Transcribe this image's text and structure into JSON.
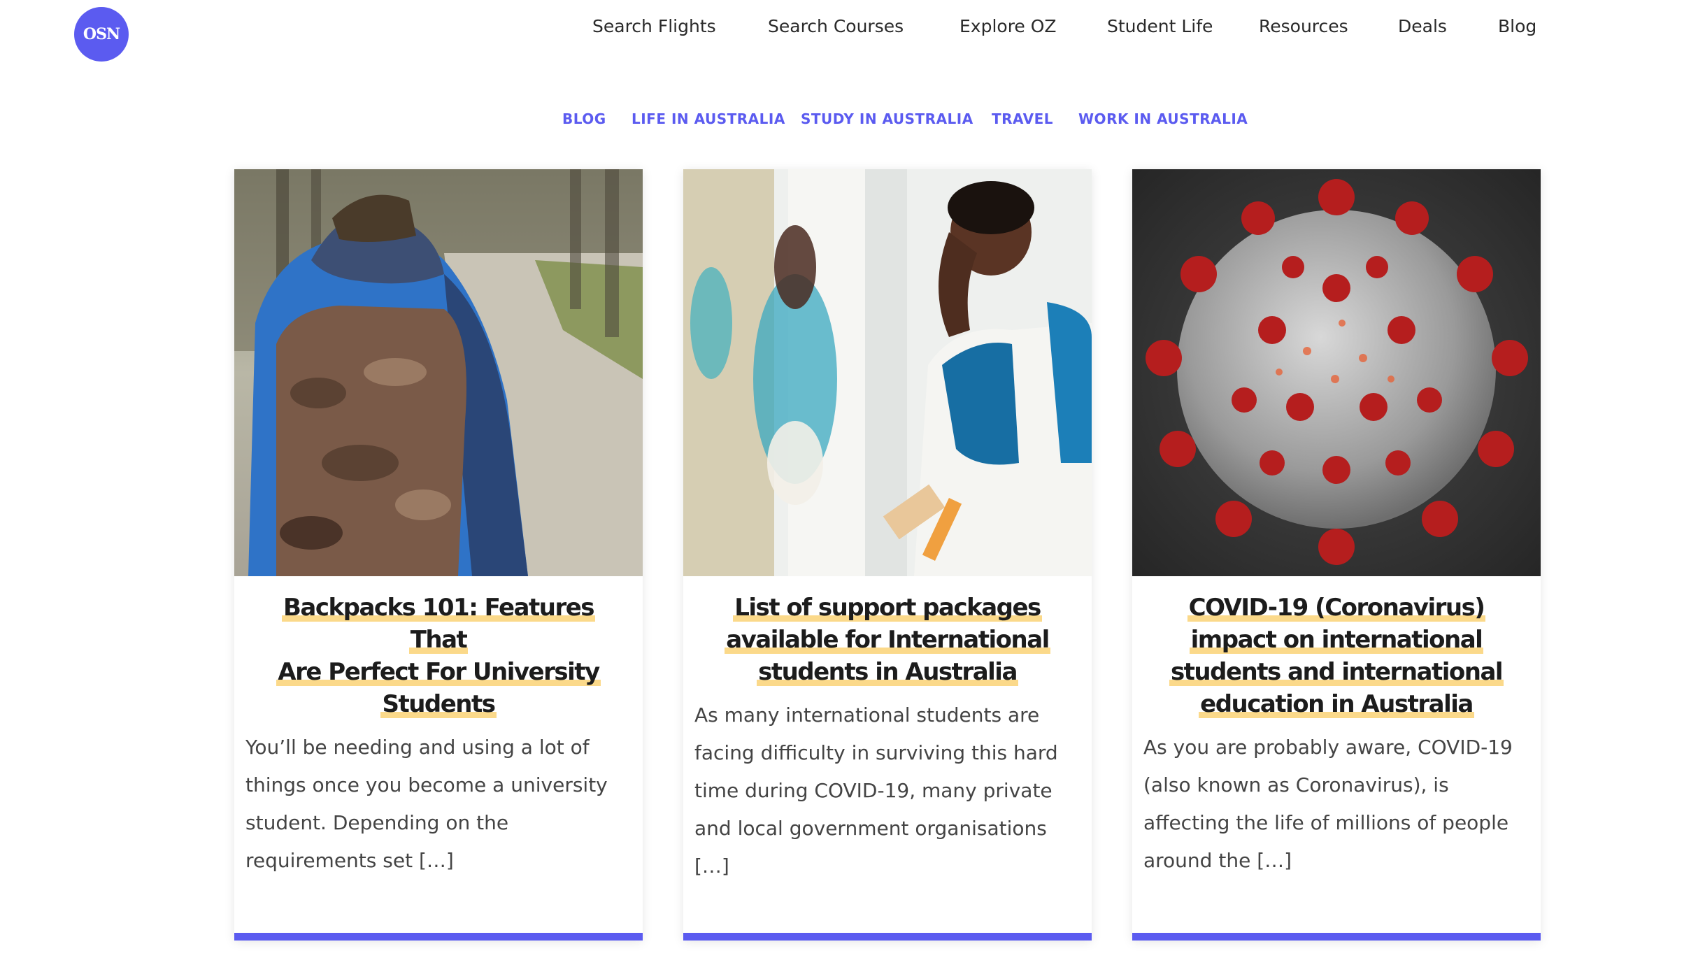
{
  "logo": {
    "text": "OSN"
  },
  "nav": {
    "items": [
      {
        "label": "Search Flights"
      },
      {
        "label": "Search Courses"
      },
      {
        "label": "Explore OZ"
      },
      {
        "label": "Student Life"
      },
      {
        "label": "Resources"
      },
      {
        "label": "Deals"
      },
      {
        "label": "Blog"
      }
    ]
  },
  "categories": {
    "items": [
      {
        "label": "BLOG"
      },
      {
        "label": "LIFE IN AUSTRALIA"
      },
      {
        "label": "STUDY IN AUSTRALIA"
      },
      {
        "label": "TRAVEL"
      },
      {
        "label": "WORK IN AUSTRALIA"
      }
    ]
  },
  "posts": [
    {
      "title_lines": [
        "Backpacks 101: Features That",
        "Are Perfect For University",
        "Students"
      ],
      "excerpt": "You’ll be needing and using a lot of things once you become a university student. Depending on the requirements set […]",
      "image_icon": "student-backpack-photo"
    },
    {
      "title_lines": [
        "List of support packages",
        "available for International",
        "students in Australia"
      ],
      "excerpt": "As many international students are facing difficulty in surviving this hard time during COVID-19, many private and local government organisations […]",
      "image_icon": "stressed-student-photo"
    },
    {
      "title_lines": [
        "COVID-19 (Coronavirus)",
        "impact on international",
        "students and international",
        "education in Australia"
      ],
      "excerpt": "As you are probably aware, COVID-19 (also known as Coronavirus), is affecting the life of millions of people around the […]",
      "image_icon": "coronavirus-photo"
    }
  ],
  "colors": {
    "accent": "#5b5bf0",
    "highlight": "#fbd98a",
    "text": "#2a2a2a"
  }
}
